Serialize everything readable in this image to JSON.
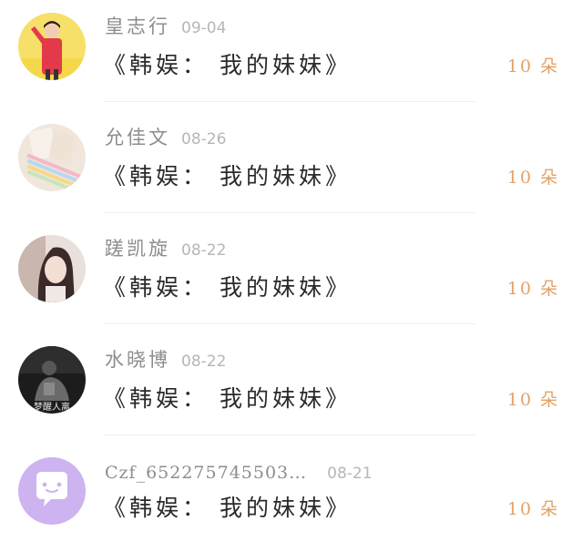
{
  "colors": {
    "name": "#8d8d8d",
    "date": "#b6b6b6",
    "title": "#2a2a2a",
    "count": "#e3a165",
    "divider": "#efefef",
    "avatar_purple": "#cdb3f0"
  },
  "items": [
    {
      "name": "皇志行",
      "date": "09-04",
      "title": "《韩娱： 我的妹妹》",
      "count": "10 朵",
      "avatar_icon": "avatar-photo"
    },
    {
      "name": "允佳文",
      "date": "08-26",
      "title": "《韩娱： 我的妹妹》",
      "count": "10 朵",
      "avatar_icon": "avatar-photo"
    },
    {
      "name": "蹉凯旋",
      "date": "08-22",
      "title": "《韩娱： 我的妹妹》",
      "count": "10 朵",
      "avatar_icon": "avatar-photo"
    },
    {
      "name": "水晓博",
      "date": "08-22",
      "title": "《韩娱： 我的妹妹》",
      "count": "10 朵",
      "avatar_icon": "avatar-photo",
      "avatar_text": "梦醒人离"
    },
    {
      "name": "Czf_652275745503…",
      "date": "08-21",
      "title": "《韩娱： 我的妹妹》",
      "count": "10 朵",
      "avatar_icon": "chat-bubble-icon"
    }
  ]
}
